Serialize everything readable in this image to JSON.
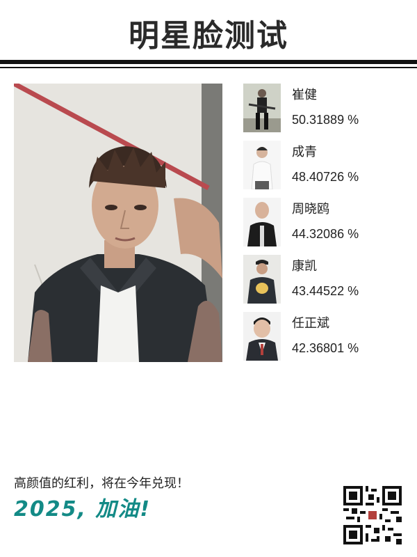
{
  "header": {
    "title": "明星脸测试"
  },
  "results": [
    {
      "name": "崔健",
      "score": "50.31889 %"
    },
    {
      "name": "成青",
      "score": "48.40726 %"
    },
    {
      "name": "周晓鸥",
      "score": "44.32086 %"
    },
    {
      "name": "康凯",
      "score": "43.44522 %"
    },
    {
      "name": "任正斌",
      "score": "42.36801 %"
    }
  ],
  "footer": {
    "slogan": "高颜值的红利，将在今年兑现！",
    "cheer": "2025, 加油!"
  },
  "colors": {
    "accent": "#138a86",
    "text": "#222222",
    "rule": "#111111"
  }
}
